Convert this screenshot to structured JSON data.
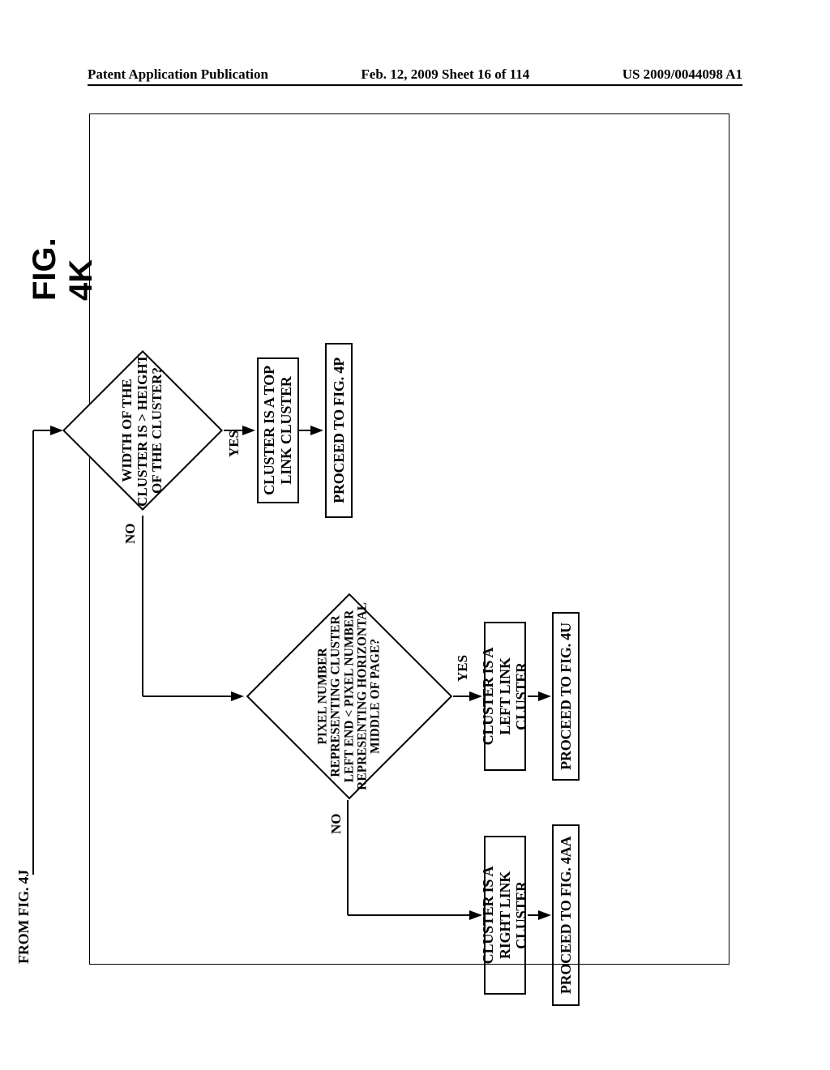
{
  "header": {
    "left": "Patent Application Publication",
    "center": "Feb. 12, 2009  Sheet 16 of 114",
    "right": "US 2009/0044098 A1"
  },
  "flow": {
    "from_ref": "FROM FIG. 4J",
    "decision1": "WIDTH OF THE CLUSTER IS > HEIGHT OF THE CLUSTER?",
    "d1_yes": "YES",
    "d1_no": "NO",
    "process_top": "CLUSTER IS A TOP LINK CLUSTER",
    "proceed_4p": "PROCEED TO FIG. 4P",
    "decision2": "PIXEL NUMBER REPRESENTING CLUSTER LEFT END < PIXEL NUMBER REPRESENTING HORIZONTAL MIDDLE OF PAGE?",
    "d2_yes": "YES",
    "d2_no": "NO",
    "process_left": "CLUSTER IS A LEFT LINK CLUSTER",
    "proceed_4u": "PROCEED TO FIG. 4U",
    "process_right": "CLUSTER IS A RIGHT LINK CLUSTER",
    "proceed_4aa": "PROCEED TO FIG. 4AA",
    "figure_title": "FIG.  4K"
  }
}
